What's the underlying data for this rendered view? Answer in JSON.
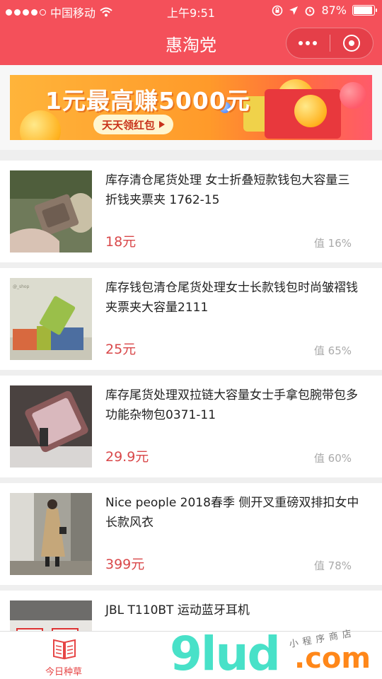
{
  "status_bar": {
    "carrier": "中国移动",
    "time": "上午9:51",
    "battery": "87%",
    "battery_level": 0.87
  },
  "nav": {
    "title": "惠淘党"
  },
  "banner": {
    "headline": "1元最高赚5000元",
    "button_label": "天天领红包"
  },
  "products": [
    {
      "name": "库存清仓尾货处理 女士折叠短款钱包大容量三折钱夹票夹 1762-15",
      "price": "18元",
      "worth": "值 16%"
    },
    {
      "name": "库存钱包清仓尾货处理女士长款钱包时尚皱褶钱夹票夹大容量2111",
      "price": "25元",
      "worth": "值 65%"
    },
    {
      "name": "库存尾货处理双拉链大容量女士手拿包腕带包多功能杂物包0371-11",
      "price": "29.9元",
      "worth": "值 60%"
    },
    {
      "name": "Nice people 2018春季 侧开叉重磅双排扣女中长款风衣",
      "price": "399元",
      "worth": "值 78%"
    },
    {
      "name": "JBL T110BT 运动蓝牙耳机",
      "price": "",
      "worth": ""
    }
  ],
  "tabbar": {
    "tabs": [
      {
        "label": "今日种草",
        "icon": "book-icon"
      },
      {
        "label": "",
        "icon": ""
      },
      {
        "label": "",
        "icon": ""
      }
    ]
  },
  "watermark": {
    "brand": "9lud",
    "domain": ".com",
    "tagline": "小程序商店"
  },
  "colors": {
    "accent": "#f4505a",
    "price": "#d9484a",
    "tab_active": "#e64545"
  }
}
